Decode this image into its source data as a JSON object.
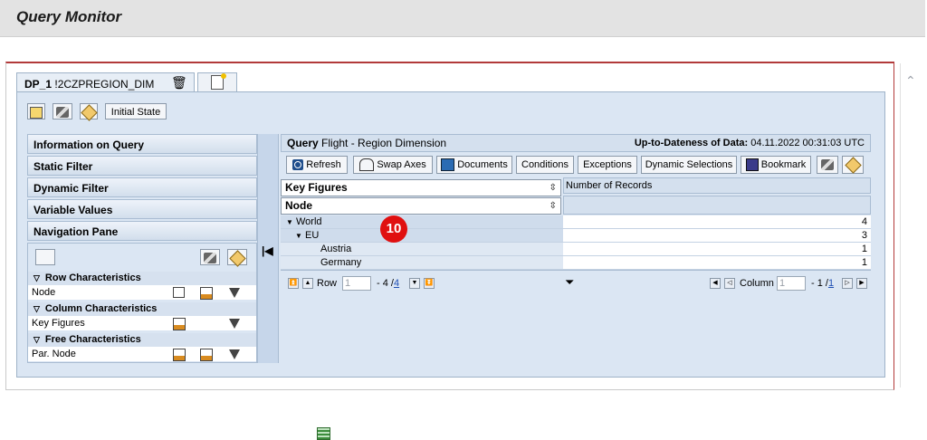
{
  "app": {
    "title": "Query Monitor"
  },
  "tabs": [
    {
      "label_bold": "DP_1",
      "label": "!2CZPREGION_DIM"
    }
  ],
  "top_toolbar": {
    "initial_state": "Initial State"
  },
  "left_sections": [
    "Information on Query",
    "Static Filter",
    "Dynamic Filter",
    "Variable Values",
    "Navigation Pane"
  ],
  "navigation": {
    "row_characteristics": {
      "title": "Row Characteristics",
      "items": [
        "Node"
      ]
    },
    "column_characteristics": {
      "title": "Column Characteristics",
      "items": [
        "Key Figures"
      ]
    },
    "free_characteristics": {
      "title": "Free Characteristics",
      "items": [
        "Par. Node"
      ]
    }
  },
  "query": {
    "label": "Query",
    "name": "Flight - Region Dimension",
    "uptodate_label": "Up-to-Dateness of Data:",
    "uptodate_value": "04.11.2022 00:31:03 UTC"
  },
  "toolbar": {
    "refresh": "Refresh",
    "swap_axes": "Swap Axes",
    "documents": "Documents",
    "conditions": "Conditions",
    "exceptions": "Exceptions",
    "dynamic_selections": "Dynamic Selections",
    "bookmark": "Bookmark"
  },
  "grid": {
    "header_key_figures": "Key Figures",
    "header_node": "Node",
    "column_header": "Number of Records",
    "rows": [
      {
        "label": "World",
        "value": "4"
      },
      {
        "label": "EU",
        "value": "3"
      },
      {
        "label": "Austria",
        "value": "1"
      },
      {
        "label": "Germany",
        "value": "1"
      }
    ]
  },
  "badge": "10",
  "pager": {
    "row_label": "Row",
    "row_value": "1",
    "row_total_prefix": "- 4 /",
    "row_total_link": "4",
    "column_label": "Column",
    "column_value": "1",
    "column_total_prefix": "- 1 /",
    "column_total_link": "1"
  },
  "colors": {
    "accent_red": "#e01010",
    "panel_blue": "#dbe6f3",
    "frame_red": "#b23a3a"
  }
}
